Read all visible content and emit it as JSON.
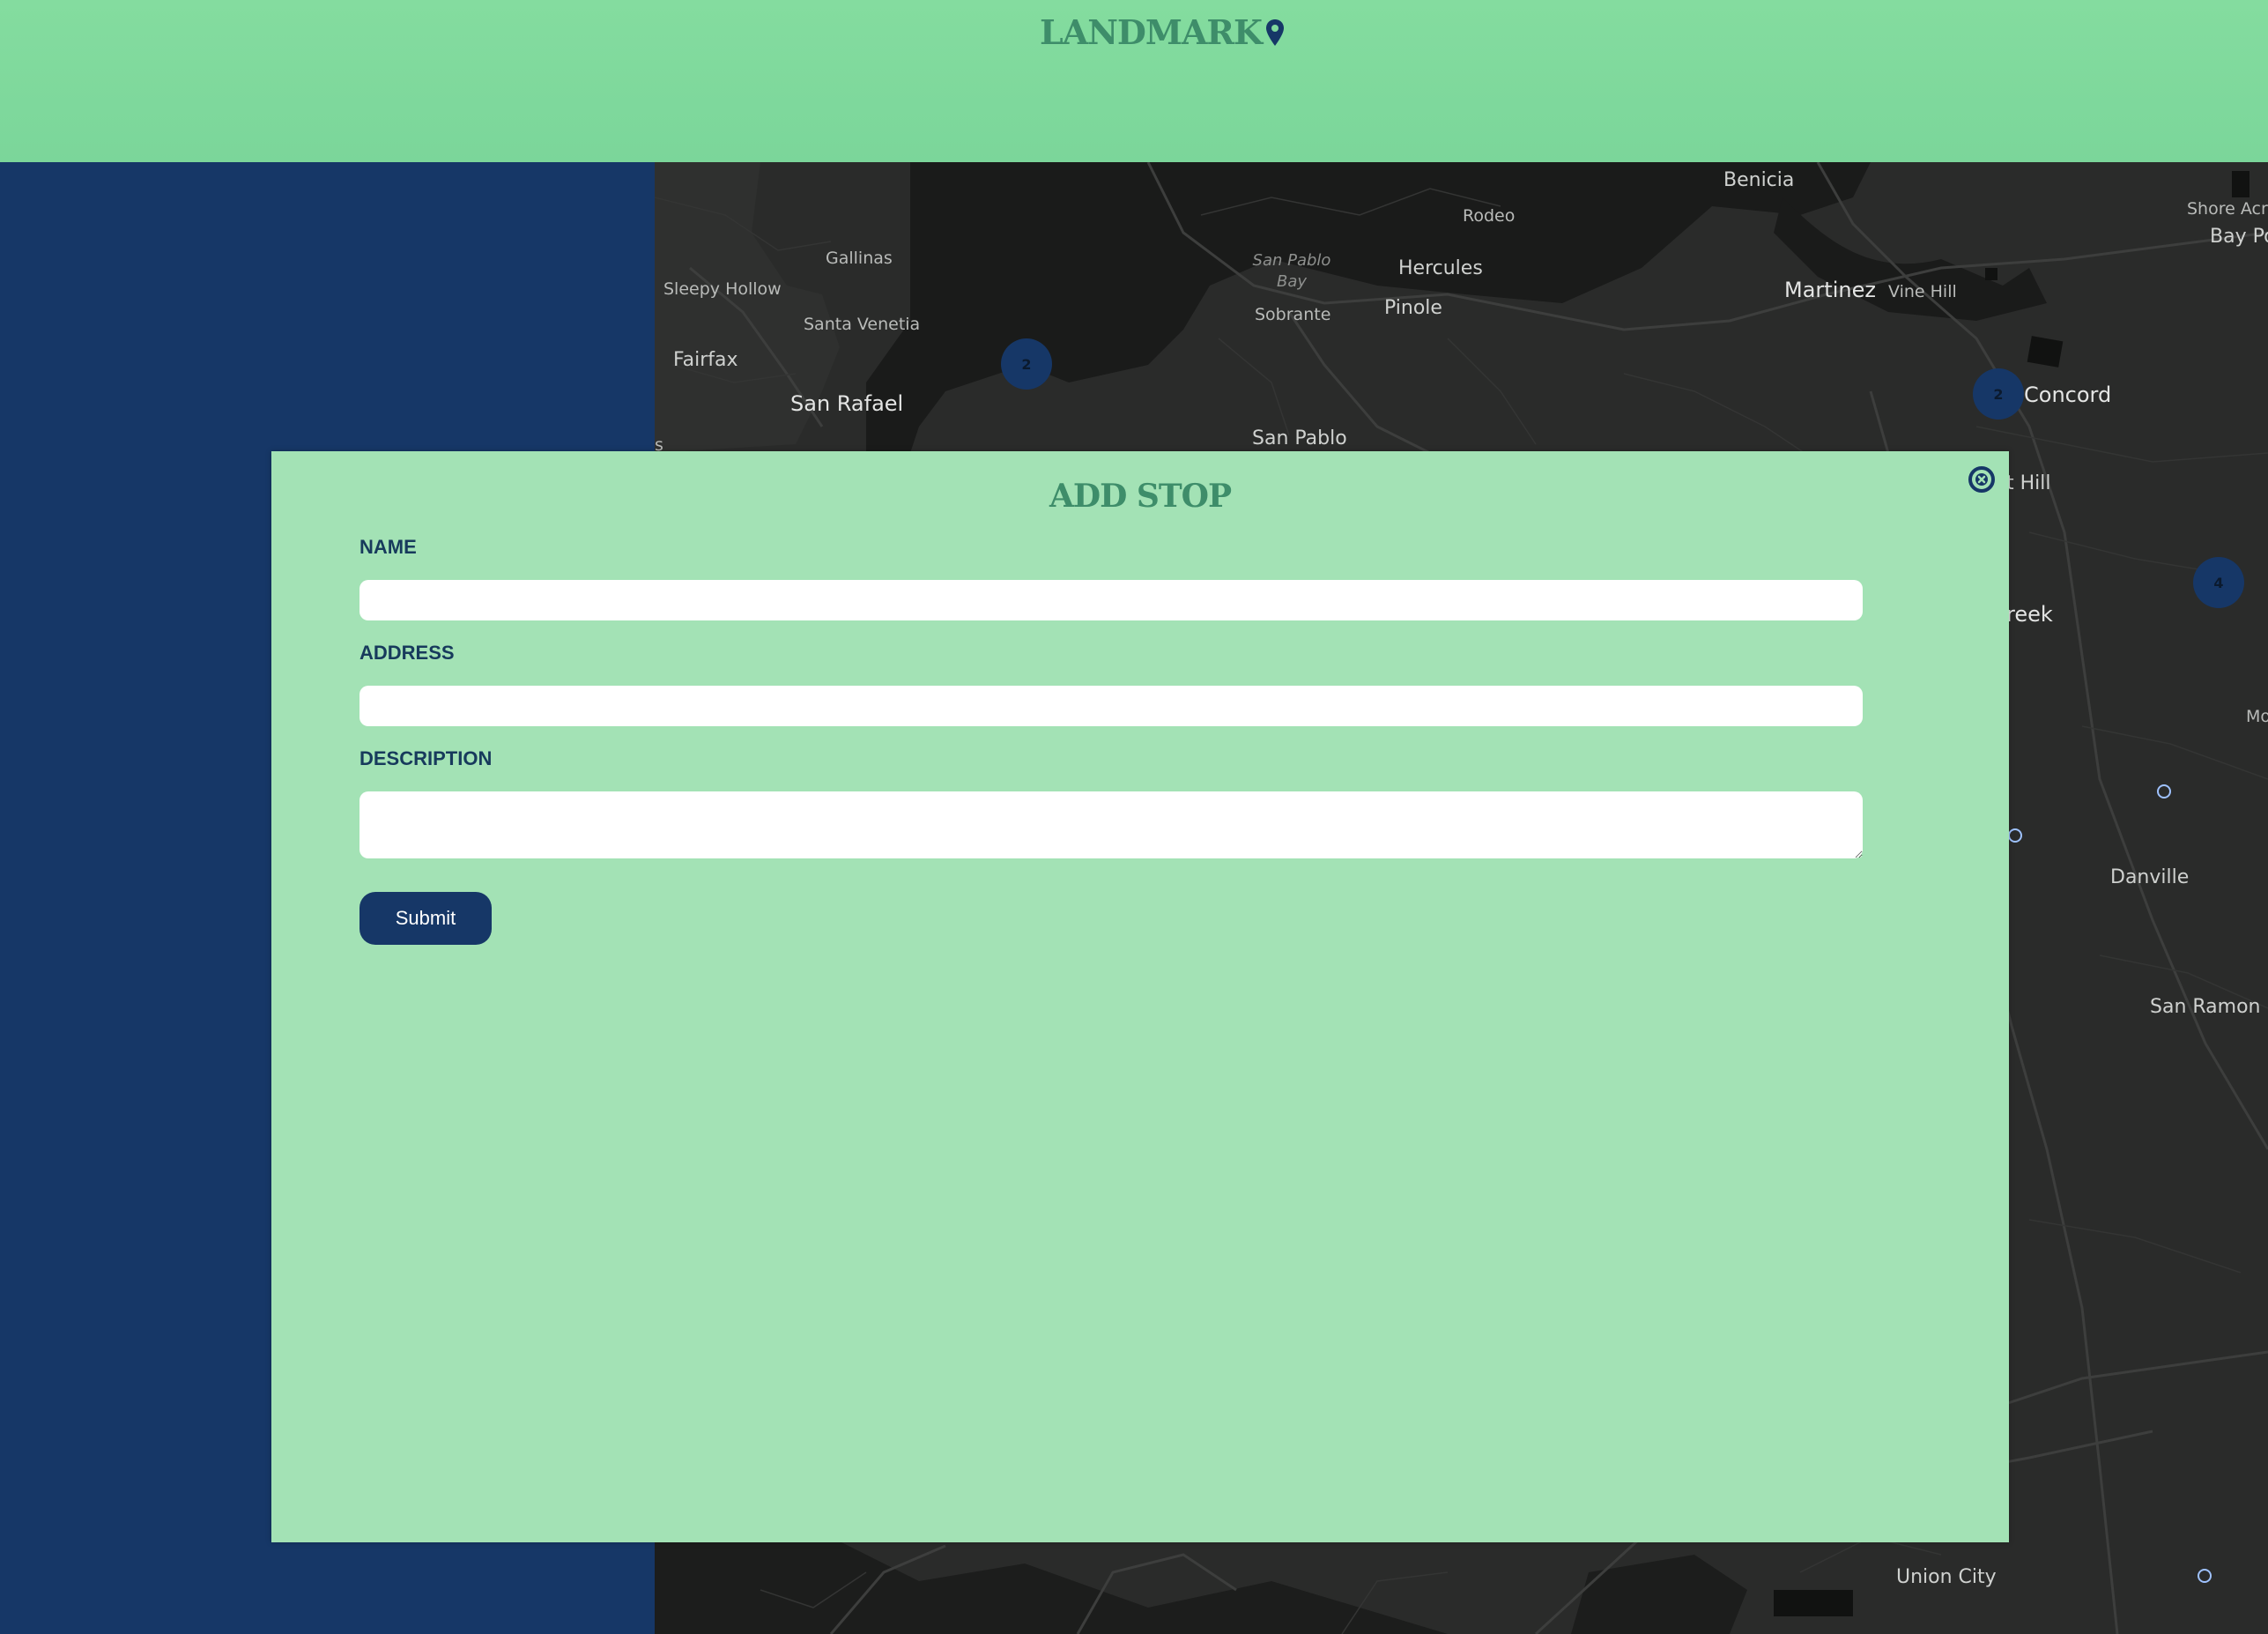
{
  "app": {
    "logo_text": "LANDMARK",
    "logo_icon": "map-pin-icon"
  },
  "colors": {
    "header": "#7fd99c",
    "sidebar": "#163767",
    "modal": "#a3e2b5",
    "accent_text": "#3e8d6a",
    "button": "#163767"
  },
  "map": {
    "places": {
      "benicia": "Benicia",
      "rodeo": "Rodeo",
      "gallinas": "Gallinas",
      "san_pablo_bay": "San Pablo Bay",
      "hercules": "Hercules",
      "martinez": "Martinez",
      "vine_hill": "Vine Hill",
      "shore_acres": "Shore Acres",
      "bay_point": "Bay Po",
      "sleepy_hollow": "Sleepy Hollow",
      "sobrante": "Sobrante",
      "pinole": "Pinole",
      "santa_venetia": "Santa Venetia",
      "fairfax": "Fairfax",
      "san_rafael": "San Rafael",
      "concord": "Concord",
      "san_pablo": "San Pablo",
      "pleasant_hill": "t Hill",
      "walnut_creek": "reek",
      "mo": "Mo",
      "danville": "Danville",
      "san_ramon": "San Ramon",
      "union_city": "Union City",
      "edge_s": "s"
    },
    "clusters": {
      "c1": "2",
      "c2": "2",
      "c3": "4"
    }
  },
  "modal": {
    "title": "ADD STOP",
    "close_icon": "close-circle-icon",
    "fields": {
      "name_label": "NAME",
      "name_value": "",
      "address_label": "ADDRESS",
      "address_value": "",
      "description_label": "DESCRIPTION",
      "description_value": ""
    },
    "submit_label": "Submit"
  }
}
